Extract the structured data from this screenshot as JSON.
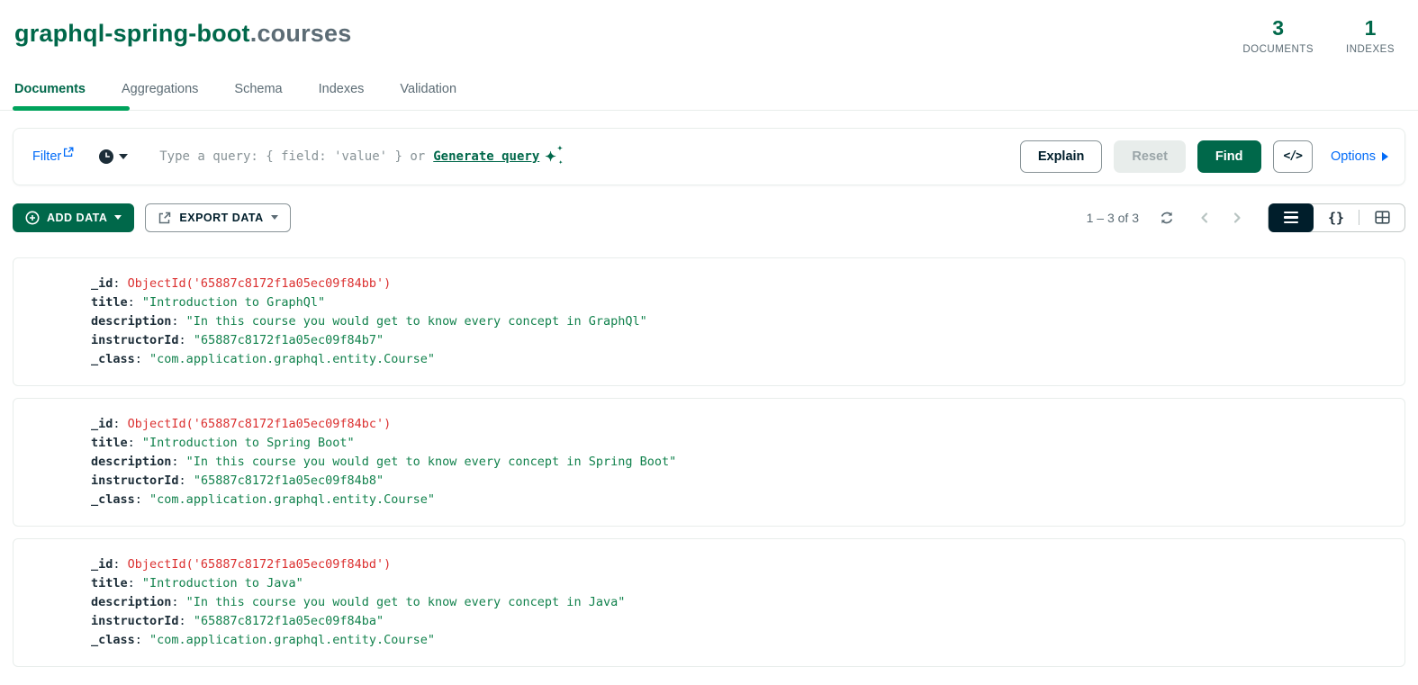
{
  "header": {
    "database": "graphql-spring-boot",
    "separator": ".",
    "collection": "courses",
    "stats": [
      {
        "value": "3",
        "label": "DOCUMENTS"
      },
      {
        "value": "1",
        "label": "INDEXES"
      }
    ]
  },
  "tabs": [
    {
      "label": "Documents",
      "active": true
    },
    {
      "label": "Aggregations",
      "active": false
    },
    {
      "label": "Schema",
      "active": false
    },
    {
      "label": "Indexes",
      "active": false
    },
    {
      "label": "Validation",
      "active": false
    }
  ],
  "query_bar": {
    "filter_label": "Filter",
    "placeholder": "Type a query: { field: 'value' } or",
    "generate_query_label": "Generate query",
    "explain_label": "Explain",
    "reset_label": "Reset",
    "find_label": "Find",
    "code_toggle_label": "</>",
    "options_label": "Options"
  },
  "toolbar": {
    "add_data_label": "ADD DATA",
    "export_data_label": "EXPORT DATA",
    "pagination_label": "1 – 3 of 3",
    "active_view": "list"
  },
  "icons": {
    "filter_link": "external-link",
    "history": "clock",
    "generate_query": "sparkle",
    "add_data": "plus-circle",
    "export_data": "export-arrow",
    "refresh": "refresh",
    "prev": "chevron-left",
    "next": "chevron-right",
    "view_list": "list-lines",
    "view_json": "curly-braces",
    "view_table": "table-grid",
    "code_toggle": "code-brackets",
    "options": "caret-right"
  },
  "colors": {
    "brand_green": "#00684A",
    "tab_underline_green": "#00A35C",
    "link_blue": "#016BF8",
    "objectid_red": "#DB3030",
    "string_green": "#12824D",
    "muted_grey": "#5C6C75",
    "border_grey": "#E8EDEB"
  },
  "documents": [
    {
      "fields": [
        {
          "key": "_id",
          "type": "objectid",
          "value": "ObjectId('65887c8172f1a05ec09f84bb')"
        },
        {
          "key": "title",
          "type": "string",
          "value": "\"Introduction to GraphQl\""
        },
        {
          "key": "description",
          "type": "string",
          "value": "\"In this course you would get to know every concept in GraphQl\""
        },
        {
          "key": "instructorId",
          "type": "string",
          "value": "\"65887c8172f1a05ec09f84b7\""
        },
        {
          "key": "_class",
          "type": "string",
          "value": "\"com.application.graphql.entity.Course\""
        }
      ]
    },
    {
      "fields": [
        {
          "key": "_id",
          "type": "objectid",
          "value": "ObjectId('65887c8172f1a05ec09f84bc')"
        },
        {
          "key": "title",
          "type": "string",
          "value": "\"Introduction to Spring Boot\""
        },
        {
          "key": "description",
          "type": "string",
          "value": "\"In this course you would get to know every concept in Spring Boot\""
        },
        {
          "key": "instructorId",
          "type": "string",
          "value": "\"65887c8172f1a05ec09f84b8\""
        },
        {
          "key": "_class",
          "type": "string",
          "value": "\"com.application.graphql.entity.Course\""
        }
      ]
    },
    {
      "fields": [
        {
          "key": "_id",
          "type": "objectid",
          "value": "ObjectId('65887c8172f1a05ec09f84bd')"
        },
        {
          "key": "title",
          "type": "string",
          "value": "\"Introduction to Java\""
        },
        {
          "key": "description",
          "type": "string",
          "value": "\"In this course you would get to know every concept in Java\""
        },
        {
          "key": "instructorId",
          "type": "string",
          "value": "\"65887c8172f1a05ec09f84ba\""
        },
        {
          "key": "_class",
          "type": "string",
          "value": "\"com.application.graphql.entity.Course\""
        }
      ]
    }
  ]
}
